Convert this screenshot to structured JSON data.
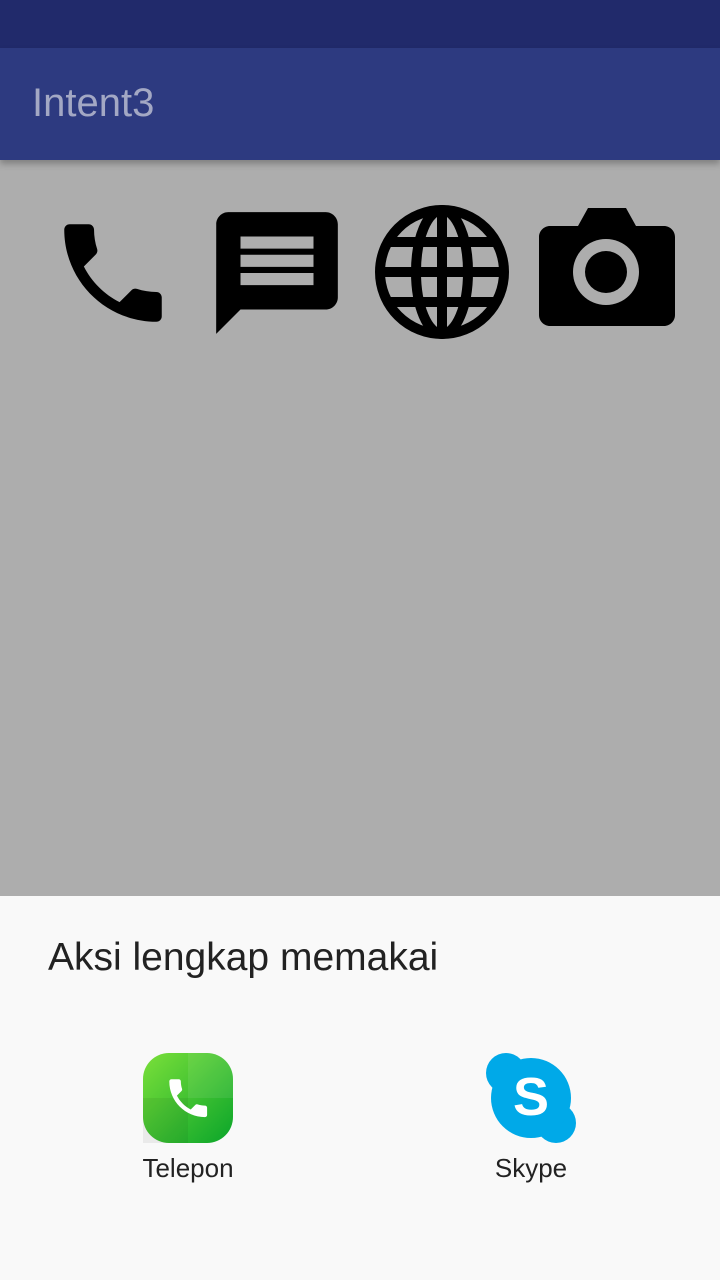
{
  "app": {
    "title": "Intent3",
    "colors": {
      "status_bar": "#212a6b",
      "app_bar": "#2d3a80",
      "content_bg": "#adadad",
      "sheet_bg": "#f9f9f9"
    }
  },
  "actions": [
    {
      "icon": "phone-icon"
    },
    {
      "icon": "message-icon"
    },
    {
      "icon": "globe-icon"
    },
    {
      "icon": "camera-icon"
    }
  ],
  "chooser": {
    "title": "Aksi lengkap memakai",
    "options": [
      {
        "label": "Telepon",
        "icon": "telepon-app-icon"
      },
      {
        "label": "Skype",
        "icon": "skype-app-icon"
      }
    ]
  }
}
